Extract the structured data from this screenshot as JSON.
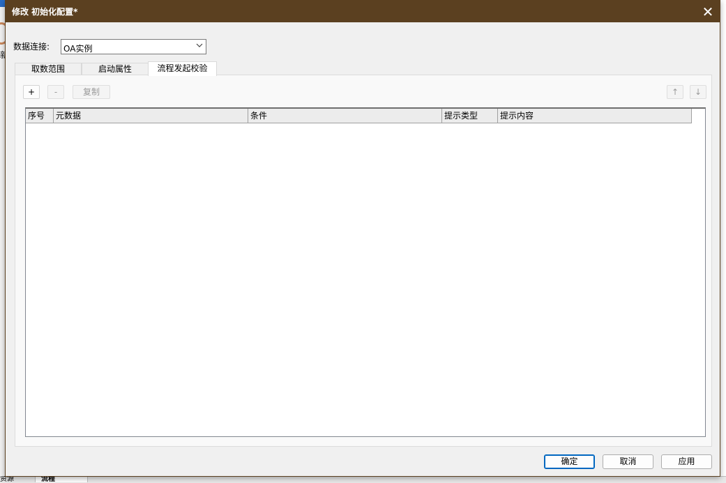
{
  "background": {
    "side_char": "新",
    "taskbar_tabs": [
      "资源",
      "流程"
    ]
  },
  "dialog": {
    "title": "修改 初始化配置*",
    "close_glyph": "✕"
  },
  "connection": {
    "label": "数据连接:",
    "value": "OA实例"
  },
  "tabs": [
    {
      "label": "取数范围",
      "active": false
    },
    {
      "label": "启动属性",
      "active": false
    },
    {
      "label": "流程发起校验",
      "active": true
    }
  ],
  "toolbar": {
    "add_label": "+",
    "remove_label": "-",
    "copy_label": "复制",
    "up_label": "↑",
    "down_label": "↓"
  },
  "table": {
    "columns": [
      "序号",
      "元数据",
      "条件",
      "提示类型",
      "提示内容"
    ],
    "rows": []
  },
  "footer": {
    "ok_label": "确定",
    "cancel_label": "取消",
    "apply_label": "应用"
  },
  "colors": {
    "titlebar": "#5b4020",
    "focus_border": "#0067c0"
  }
}
